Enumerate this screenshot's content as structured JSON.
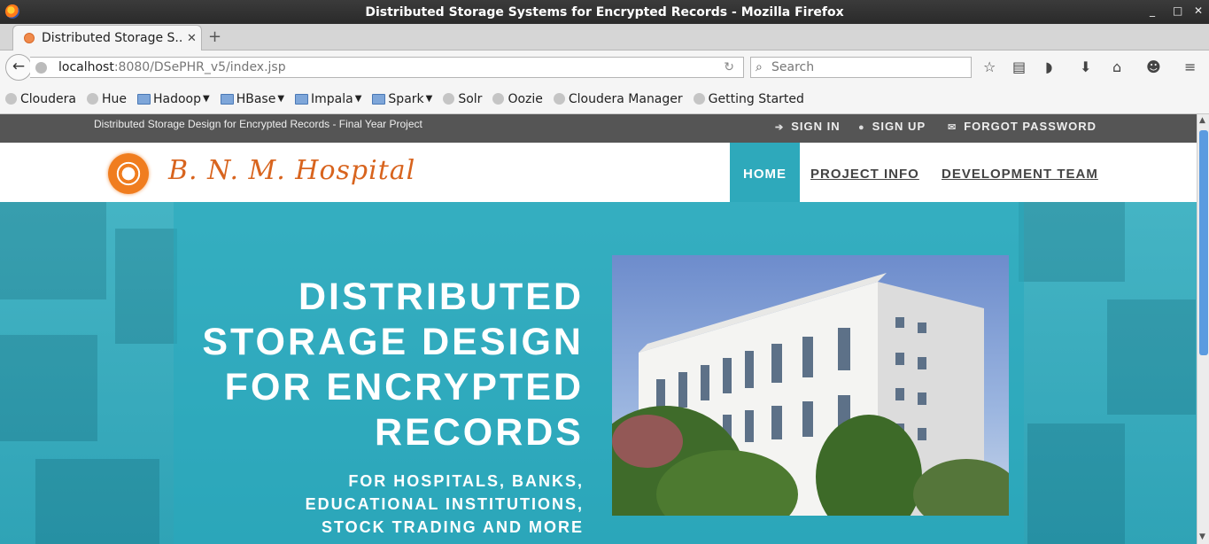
{
  "window": {
    "title": "Distributed Storage Systems for Encrypted Records - Mozilla Firefox",
    "controls": [
      "_",
      "□",
      "✕"
    ]
  },
  "tab": {
    "label": "Distributed Storage S...",
    "close": "✕",
    "new_tab": "+"
  },
  "navbar": {
    "url_host": "localhost",
    "url_path": ":8080/DSePHR_v5/index.jsp",
    "search_placeholder": "Search",
    "icons": [
      "star-icon",
      "reading-list-icon",
      "pocket-icon",
      "download-icon",
      "home-icon",
      "chat-icon",
      "menu-icon"
    ]
  },
  "bookmarks": [
    {
      "label": "Cloudera",
      "type": "link"
    },
    {
      "label": "Hue",
      "type": "link"
    },
    {
      "label": "Hadoop",
      "type": "folder"
    },
    {
      "label": "HBase",
      "type": "folder"
    },
    {
      "label": "Impala",
      "type": "folder"
    },
    {
      "label": "Spark",
      "type": "folder"
    },
    {
      "label": "Solr",
      "type": "link"
    },
    {
      "label": "Oozie",
      "type": "link"
    },
    {
      "label": "Cloudera Manager",
      "type": "link"
    },
    {
      "label": "Getting Started",
      "type": "link"
    }
  ],
  "site": {
    "tagline": "Distributed Storage Design for Encrypted Records - Final Year Project",
    "top_links": {
      "sign_in": "SIGN IN",
      "sign_up": "SIGN UP",
      "forgot": "FORGOT PASSWORD"
    },
    "logo_text": "B. N. M. Hospital",
    "menu": {
      "home": "HOME",
      "project_info": "PROJECT INFO",
      "dev_team": "DEVELOPMENT TEAM"
    },
    "hero": {
      "title_lines": [
        "DISTRIBUTED",
        "STORAGE DESIGN",
        "FOR ENCRYPTED",
        "RECORDS"
      ],
      "sub_lines": [
        "FOR HOSPITALS, BANKS,",
        "EDUCATIONAL INSTITUTIONS,",
        "STOCK TRADING AND MORE"
      ]
    }
  },
  "colors": {
    "accent": "#2ea9bb",
    "logo": "#d8641e",
    "topbar": "#555555"
  }
}
